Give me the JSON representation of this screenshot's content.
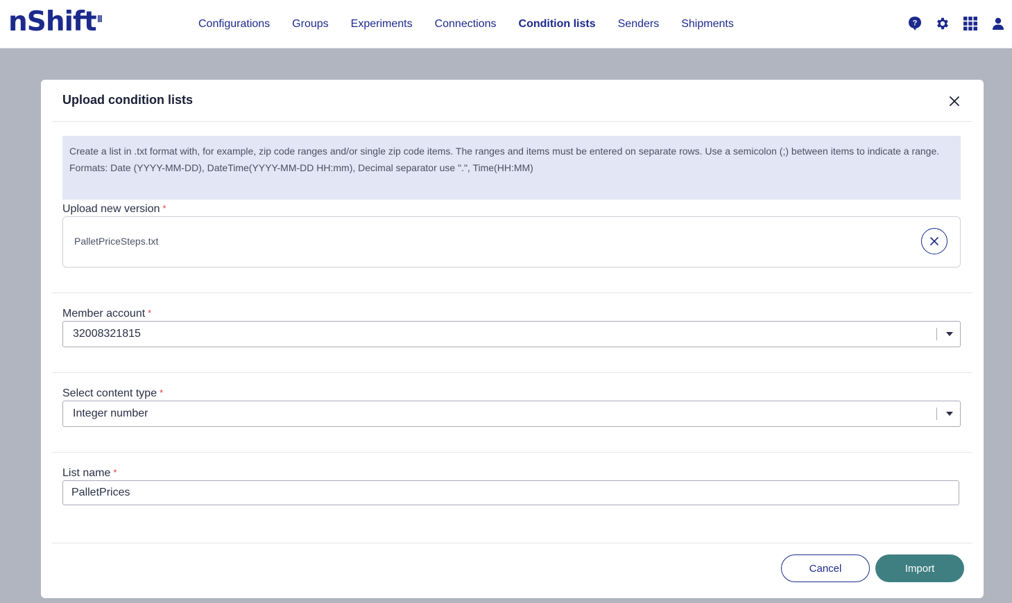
{
  "app": {
    "logo_text": "nShift"
  },
  "nav": {
    "items": [
      {
        "label": "Configurations",
        "active": false
      },
      {
        "label": "Groups",
        "active": false
      },
      {
        "label": "Experiments",
        "active": false
      },
      {
        "label": "Connections",
        "active": false
      },
      {
        "label": "Condition lists",
        "active": true
      },
      {
        "label": "Senders",
        "active": false
      },
      {
        "label": "Shipments",
        "active": false
      }
    ]
  },
  "header_icons": [
    "help-icon",
    "gear-icon",
    "apps-grid-icon",
    "user-icon"
  ],
  "modal": {
    "title": "Upload condition lists",
    "info_line1": "Create a list in .txt format with, for example, zip code ranges and/or single zip code items. The ranges and items must be entered on separate rows. Use a semicolon (;) between items to indicate a range.",
    "info_line2": "Formats: Date (YYYY-MM-DD), DateTime(YYYY-MM-DD HH:mm), Decimal separator use \".\", Time(HH:MM)",
    "upload": {
      "label": "Upload new version",
      "file_name": "PalletPriceSteps.txt"
    },
    "member_account": {
      "label": "Member account",
      "value": "32008321815"
    },
    "content_type": {
      "label": "Select content type",
      "value": "Integer number"
    },
    "list_name": {
      "label": "List name",
      "value": "PalletPrices"
    },
    "required_mark": "*",
    "cancel_label": "Cancel",
    "import_label": "Import"
  },
  "colors": {
    "brand": "#1c2a8c",
    "accent": "#3f7f82",
    "info_bg": "#e3e6f4",
    "required": "#e53935"
  }
}
